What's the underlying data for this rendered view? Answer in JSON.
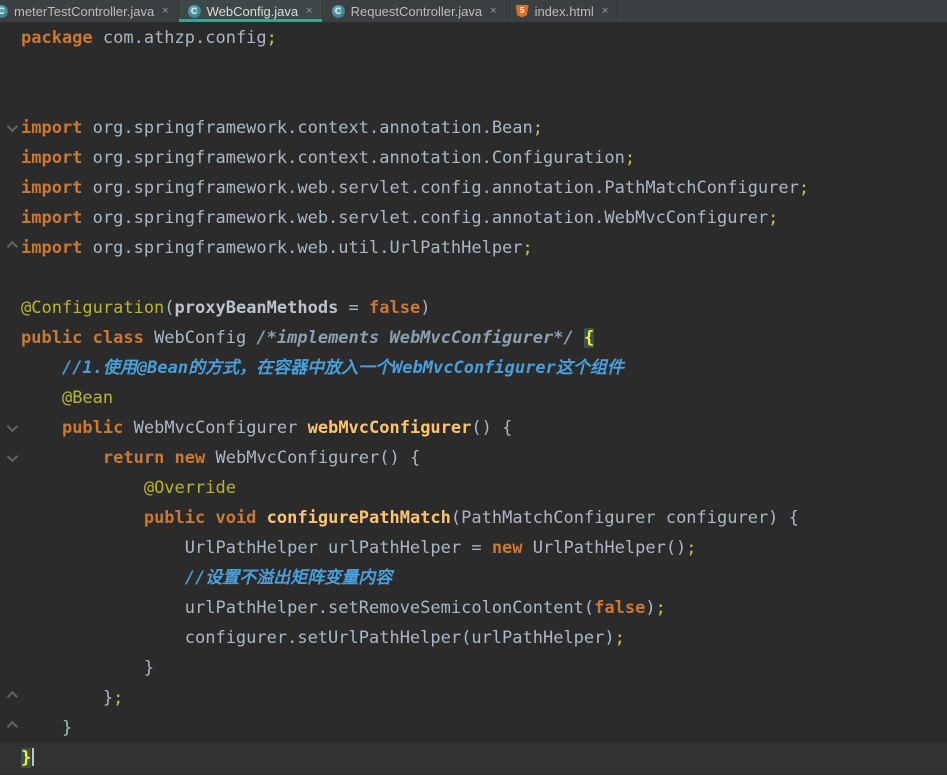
{
  "colors": {
    "editor_bg": "#2B2B2B",
    "tab_bar_bg": "#3C3F41",
    "active_tab_underline": "#3AA397",
    "keyword": "#CC7832",
    "identifier": "#A9B7C6",
    "annotation": "#BBB529",
    "method_declaration": "#FFC66D",
    "line_comment": "#4A9FDB",
    "block_comment": "#8C9FB0",
    "semicolon": "#C8C14F",
    "brace_match_bg": "#3B514D",
    "brace_match_fg": "#FFEF28",
    "caret_line_bg": "#323232"
  },
  "icon_glyphs": {
    "class-icon": "C",
    "html-icon": "5"
  },
  "tab_bar": {
    "tabs": [
      {
        "label": "meterTestController.java",
        "icon": "class-icon",
        "close": "×",
        "active": false,
        "clipped": true
      },
      {
        "label": "WebConfig.java",
        "icon": "class-icon",
        "close": "×",
        "active": true,
        "clipped": false
      },
      {
        "label": "RequestController.java",
        "icon": "class-icon",
        "close": "×",
        "active": false,
        "clipped": false
      },
      {
        "label": "index.html",
        "icon": "html-icon",
        "close": "×",
        "active": false,
        "clipped": false
      }
    ]
  },
  "editor": {
    "lines": [
      {
        "fold": "",
        "caret": false,
        "tokens": [
          {
            "s": "package",
            "c": "kw"
          },
          {
            "s": " com.athzp.config",
            "c": "id"
          },
          {
            "s": ";",
            "c": "semi"
          }
        ]
      },
      {
        "fold": "",
        "caret": false,
        "tokens": []
      },
      {
        "fold": "",
        "caret": false,
        "tokens": []
      },
      {
        "fold": "down",
        "caret": false,
        "tokens": [
          {
            "s": "import",
            "c": "kw"
          },
          {
            "s": " org.springframework.context.annotation.Bean",
            "c": "id"
          },
          {
            "s": ";",
            "c": "semi"
          }
        ]
      },
      {
        "fold": "",
        "caret": false,
        "tokens": [
          {
            "s": "import",
            "c": "kw"
          },
          {
            "s": " org.springframework.context.annotation.Configuration",
            "c": "id"
          },
          {
            "s": ";",
            "c": "semi"
          }
        ]
      },
      {
        "fold": "",
        "caret": false,
        "tokens": [
          {
            "s": "import",
            "c": "kw"
          },
          {
            "s": " org.springframework.web.servlet.config.annotation.PathMatchConfigurer",
            "c": "id"
          },
          {
            "s": ";",
            "c": "semi"
          }
        ]
      },
      {
        "fold": "",
        "caret": false,
        "tokens": [
          {
            "s": "import",
            "c": "kw"
          },
          {
            "s": " org.springframework.web.servlet.config.annotation.WebMvcConfigurer",
            "c": "id"
          },
          {
            "s": ";",
            "c": "semi"
          }
        ]
      },
      {
        "fold": "up",
        "caret": false,
        "tokens": [
          {
            "s": "import",
            "c": "kw"
          },
          {
            "s": " org.springframework.web.util.UrlPathHelper",
            "c": "id"
          },
          {
            "s": ";",
            "c": "semi"
          }
        ]
      },
      {
        "fold": "",
        "caret": false,
        "tokens": []
      },
      {
        "fold": "",
        "caret": false,
        "tokens": [
          {
            "s": "@Configuration",
            "c": "ann"
          },
          {
            "s": "(",
            "c": "id"
          },
          {
            "s": "proxyBeanMethods",
            "c": "attr"
          },
          {
            "s": " = ",
            "c": "id"
          },
          {
            "s": "false",
            "c": "kw"
          },
          {
            "s": ")",
            "c": "id"
          }
        ]
      },
      {
        "fold": "",
        "caret": false,
        "tokens": [
          {
            "s": "public class",
            "c": "kw"
          },
          {
            "s": " WebConfig ",
            "c": "id"
          },
          {
            "s": "/*implements WebMvcConfigurer*/",
            "c": "bcmt"
          },
          {
            "s": " ",
            "c": "id"
          },
          {
            "s": "{",
            "c": "brhl"
          }
        ]
      },
      {
        "fold": "",
        "caret": false,
        "tokens": [
          {
            "s": "    ",
            "c": "id"
          },
          {
            "s": "//1.使用@Bean的方式，在容器中放入一个WebMvcConfigurer这个组件",
            "c": "cmt"
          }
        ]
      },
      {
        "fold": "",
        "caret": false,
        "tokens": [
          {
            "s": "    ",
            "c": "id"
          },
          {
            "s": "@Bean",
            "c": "ann"
          }
        ]
      },
      {
        "fold": "down",
        "caret": false,
        "tokens": [
          {
            "s": "    ",
            "c": "id"
          },
          {
            "s": "public",
            "c": "kw"
          },
          {
            "s": " WebMvcConfigurer ",
            "c": "id"
          },
          {
            "s": "webMvcConfigurer",
            "c": "fn"
          },
          {
            "s": "() {",
            "c": "id"
          }
        ]
      },
      {
        "fold": "down",
        "caret": false,
        "tokens": [
          {
            "s": "        ",
            "c": "id"
          },
          {
            "s": "return new",
            "c": "kw"
          },
          {
            "s": " WebMvcConfigurer() {",
            "c": "id"
          }
        ]
      },
      {
        "fold": "",
        "caret": false,
        "tokens": [
          {
            "s": "            ",
            "c": "id"
          },
          {
            "s": "@Override",
            "c": "ann"
          }
        ]
      },
      {
        "fold": "",
        "caret": false,
        "tokens": [
          {
            "s": "            ",
            "c": "id"
          },
          {
            "s": "public void",
            "c": "kw"
          },
          {
            "s": " ",
            "c": "id"
          },
          {
            "s": "configurePathMatch",
            "c": "fn"
          },
          {
            "s": "(PathMatchConfigurer configurer) {",
            "c": "id"
          }
        ]
      },
      {
        "fold": "",
        "caret": false,
        "tokens": [
          {
            "s": "                UrlPathHelper urlPathHelper = ",
            "c": "id"
          },
          {
            "s": "new",
            "c": "kw"
          },
          {
            "s": " UrlPathHelper()",
            "c": "id"
          },
          {
            "s": ";",
            "c": "semi"
          }
        ]
      },
      {
        "fold": "",
        "caret": false,
        "tokens": [
          {
            "s": "                ",
            "c": "id"
          },
          {
            "s": "//设置不溢出矩阵变量内容",
            "c": "cmt"
          }
        ]
      },
      {
        "fold": "",
        "caret": false,
        "tokens": [
          {
            "s": "                urlPathHelper.setRemoveSemicolonContent(",
            "c": "id"
          },
          {
            "s": "false",
            "c": "kw"
          },
          {
            "s": ")",
            "c": "id"
          },
          {
            "s": ";",
            "c": "semi"
          }
        ]
      },
      {
        "fold": "",
        "caret": false,
        "tokens": [
          {
            "s": "                configurer.setUrlPathHelper(urlPathHelper)",
            "c": "id"
          },
          {
            "s": ";",
            "c": "semi"
          }
        ]
      },
      {
        "fold": "",
        "caret": false,
        "tokens": [
          {
            "s": "            }",
            "c": "id"
          }
        ]
      },
      {
        "fold": "up",
        "caret": false,
        "tokens": [
          {
            "s": "        }",
            "c": "id"
          },
          {
            "s": ";",
            "c": "semi"
          }
        ]
      },
      {
        "fold": "up",
        "caret": false,
        "tokens": [
          {
            "s": "    }",
            "c": "id"
          }
        ]
      },
      {
        "fold": "",
        "caret": true,
        "tokens": [
          {
            "s": "}",
            "c": "brhl"
          }
        ]
      }
    ]
  }
}
